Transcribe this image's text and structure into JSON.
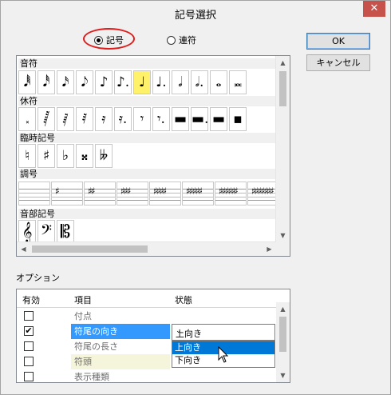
{
  "window": {
    "title": "記号選択",
    "close": "✕"
  },
  "mode": {
    "option1": "記号",
    "option2": "連符"
  },
  "buttons": {
    "ok": "OK",
    "cancel": "キャンセル"
  },
  "categories": {
    "notes": "音符",
    "rests": "休符",
    "accidentals": "臨時記号",
    "keys": "調号",
    "clefs": "音部記号"
  },
  "note_symbols": [
    "𝅘𝅥𝅱",
    "𝅘𝅥𝅰",
    "𝅘𝅥𝅯",
    "𝅘𝅥𝅮",
    "♪",
    "♪.",
    "♩",
    "♩.",
    "𝅗𝅥",
    "𝅗𝅥.",
    "𝅝",
    "𝅜"
  ],
  "rest_symbols": [
    "𝅃",
    "𝅂",
    "𝅁",
    "𝅀",
    "𝄿",
    "𝄿.",
    "𝄾",
    "𝄾.",
    "▬",
    "▬.",
    "▬",
    "▪"
  ],
  "accidental_symbols": [
    "♮",
    "♯",
    "♭",
    "𝄪",
    "𝄫"
  ],
  "key_symbols": [
    "",
    "♯",
    "♯♯",
    "♯♯♯",
    "♯♯♯♯",
    "♯♯♯♯♯",
    "♯♯♯♯♯♯",
    "♯♯♯♯♯♯♯"
  ],
  "clef_symbols": [
    "𝄞",
    "𝄢",
    "𝄡"
  ],
  "options": {
    "label": "オプション",
    "headers": {
      "enabled": "有効",
      "item": "項目",
      "state": "状態"
    },
    "rows": [
      {
        "checked": false,
        "name": "付点",
        "style": "normal"
      },
      {
        "checked": true,
        "name": "符尾の向き",
        "style": "selected"
      },
      {
        "checked": false,
        "name": "符尾の長さ",
        "style": "normal"
      },
      {
        "checked": false,
        "name": "符頭",
        "style": "beige"
      },
      {
        "checked": false,
        "name": "表示種類",
        "style": "normal"
      }
    ],
    "combo_value": "上向き",
    "dropdown": [
      "上向き",
      "下向き"
    ]
  },
  "colors": {
    "selected_cell": "#fff26a",
    "selection": "#3399ff",
    "highlight_oval": "#e01b1b",
    "close_button": "#c7514b"
  }
}
